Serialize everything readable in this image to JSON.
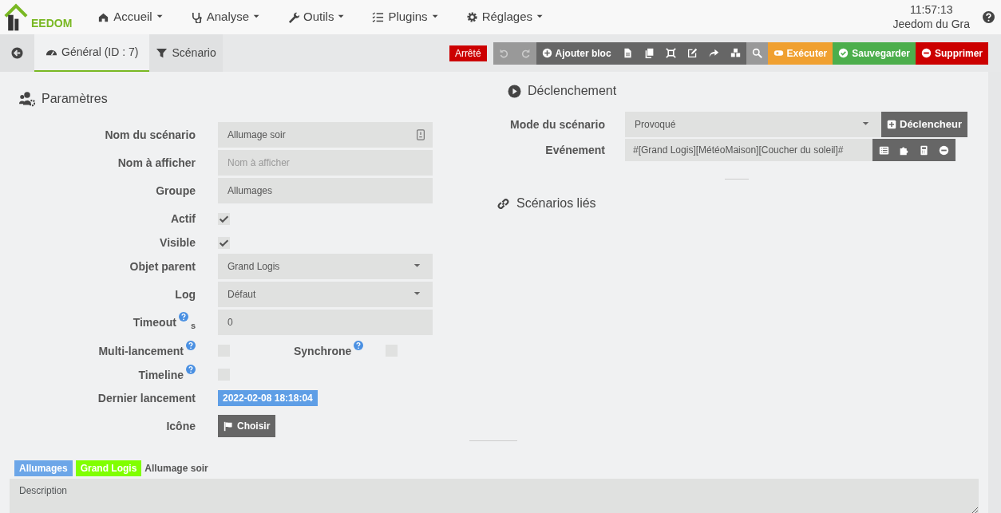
{
  "navbar": {
    "logo_text": "EEDOM",
    "menus": [
      {
        "label": "Accueil"
      },
      {
        "label": "Analyse"
      },
      {
        "label": "Outils"
      },
      {
        "label": "Plugins"
      },
      {
        "label": "Réglages"
      }
    ],
    "clock": "11:57:13",
    "site_name": "Jeedom du Gra"
  },
  "tabs": [
    {
      "label": "Général (ID : 7)",
      "selected": true
    },
    {
      "label": "Scénario",
      "selected": false
    }
  ],
  "status": "Arrêté",
  "toolbar": [
    {
      "kind": "undo",
      "disabled": true
    },
    {
      "kind": "redo",
      "disabled": true
    },
    {
      "kind": "add",
      "label": "Ajouter bloc",
      "disabled": false
    },
    {
      "kind": "file",
      "disabled": false
    },
    {
      "kind": "copy",
      "disabled": false
    },
    {
      "kind": "expand",
      "disabled": false
    },
    {
      "kind": "edit",
      "disabled": false
    },
    {
      "kind": "share",
      "disabled": false
    },
    {
      "kind": "cubes",
      "disabled": false
    },
    {
      "kind": "search",
      "disabled": false
    },
    {
      "kind": "run",
      "label": "Exécuter",
      "disabled": false
    },
    {
      "kind": "save",
      "label": "Sauvegarder",
      "disabled": false
    },
    {
      "kind": "delete",
      "label": "Supprimer",
      "disabled": false
    }
  ],
  "parameters": {
    "title": "Paramètres",
    "fields": [
      {
        "kind": "text",
        "label": "Nom du scénario",
        "value": "Allumage soir"
      },
      {
        "kind": "text",
        "label": "Nom à afficher",
        "placeholder": "Nom à afficher"
      },
      {
        "kind": "text",
        "label": "Groupe",
        "value": "Allumages"
      },
      {
        "kind": "checkbox",
        "label": "Actif",
        "checked": true
      },
      {
        "kind": "checkbox",
        "label": "Visible",
        "checked": true
      },
      {
        "kind": "select",
        "label": "Objet parent",
        "value": "Grand Logis"
      },
      {
        "kind": "select",
        "label": "Log",
        "value": "Défaut"
      },
      {
        "kind": "text",
        "label": "Timeout",
        "help": true,
        "unit": "s",
        "value": "0"
      },
      {
        "kind": "checkbox",
        "label": "Multi-lancement",
        "help": true,
        "checked": false,
        "extra": {
          "label": "Synchrone",
          "help": true,
          "checked": false
        }
      },
      {
        "kind": "checkbox",
        "label": "Timeline",
        "help": true,
        "checked": false
      },
      {
        "kind": "date",
        "label": "Dernier lancement",
        "value": "2022-02-08 18:18:04"
      },
      {
        "kind": "button",
        "label": "Icône",
        "value": "Choisir"
      }
    ]
  },
  "trigger": {
    "title": "Déclenchement",
    "mode_label": "Mode du scénario",
    "mode": "Provoqué",
    "add_button": "Déclencheur",
    "event_label": "Evénement",
    "event": "#[Grand Logis][MétéoMaison][Coucher du soleil]#"
  },
  "linked": {
    "title": "Scénarios liés"
  },
  "footer": {
    "tags": [
      {
        "text": "Allumages",
        "color": "#6ca6e8"
      },
      {
        "text": "Grand Logis",
        "color": "#80ff00"
      }
    ],
    "name": "Allumage soir",
    "description_placeholder": "Description"
  }
}
